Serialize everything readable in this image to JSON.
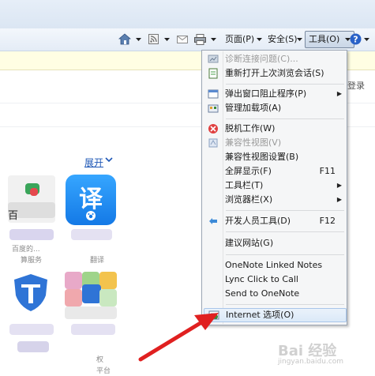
{
  "toolbar": {
    "page_label": "页面(P)",
    "safety_label": "安全(S)",
    "tools_label": "工具(O)"
  },
  "page": {
    "login_text": "登录",
    "expand_text": "展开",
    "apps": [
      {
        "label": "百度的..."
      },
      {
        "label": "翻译"
      },
      {
        "label": "平台"
      }
    ]
  },
  "menu": {
    "items": [
      {
        "label": "诊断连接问题(C)...",
        "disabled": true
      },
      {
        "label": "重新打开上次浏览会话(S)"
      },
      {
        "label": "弹出窗口阻止程序(P)",
        "submenu": true
      },
      {
        "label": "管理加载项(A)"
      },
      {
        "label": "脱机工作(W)"
      },
      {
        "label": "兼容性视图(V)",
        "disabled": true
      },
      {
        "label": "兼容性视图设置(B)"
      },
      {
        "label": "全屏显示(F)",
        "shortcut": "F11"
      },
      {
        "label": "工具栏(T)",
        "submenu": true
      },
      {
        "label": "浏览器栏(X)",
        "submenu": true
      },
      {
        "label": "开发人员工具(D)",
        "shortcut": "F12"
      },
      {
        "label": "建议网站(G)"
      },
      {
        "label": "OneNote Linked Notes"
      },
      {
        "label": "Lync Click to Call"
      },
      {
        "label": "Send to OneNote"
      },
      {
        "label": "Internet 选项(O)",
        "highlighted": true
      }
    ]
  },
  "watermark": {
    "text": "Bai 经验",
    "sub": "jingyan.baidu.com"
  }
}
